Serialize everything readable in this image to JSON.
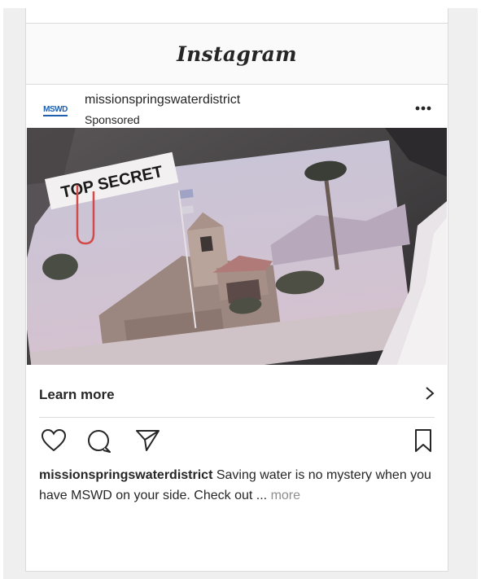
{
  "header": {
    "logo_text": "Instagram"
  },
  "post": {
    "avatar_text": "MSWD",
    "username": "missionspringswaterdistrict",
    "sponsored_label": "Sponsored",
    "more_icon": "more-dots-icon",
    "media": {
      "stamp_text": "TOP SECRET"
    },
    "cta": {
      "label": "Learn more",
      "chevron": "›"
    },
    "actions": [
      "heart-icon",
      "comment-icon",
      "share-icon",
      "bookmark-icon"
    ],
    "caption": {
      "username": "missionspringswaterdistrict",
      "text": " Saving water is no mystery when you have MSWD on your side. Check out ... ",
      "more_label": "more"
    }
  },
  "colors": {
    "accent_blue": "#1f5fae",
    "border": "#dbdbdb",
    "muted": "#8e8e8e"
  }
}
